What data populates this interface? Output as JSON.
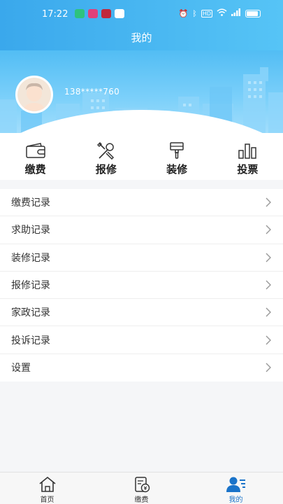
{
  "status_bar": {
    "time": "17:22",
    "signal_text": "HD"
  },
  "header": {
    "title": "我的"
  },
  "profile": {
    "phone": "138*****760"
  },
  "quick_nav": [
    {
      "label": "缴费",
      "icon": "wallet-icon"
    },
    {
      "label": "报修",
      "icon": "tools-icon"
    },
    {
      "label": "装修",
      "icon": "paint-brush-icon"
    },
    {
      "label": "投票",
      "icon": "bar-chart-icon"
    }
  ],
  "menu": [
    {
      "label": "缴费记录"
    },
    {
      "label": "求助记录"
    },
    {
      "label": "装修记录"
    },
    {
      "label": "报修记录"
    },
    {
      "label": "家政记录"
    },
    {
      "label": "投诉记录"
    },
    {
      "label": "设置"
    }
  ],
  "tabs": [
    {
      "label": "首页",
      "icon": "home-icon"
    },
    {
      "label": "缴费",
      "icon": "payment-bill-icon"
    },
    {
      "label": "我的",
      "icon": "user-profile-icon",
      "active": true
    }
  ],
  "colors": {
    "header_blue": "#3aa8ec",
    "active_tab": "#1a73c9"
  }
}
